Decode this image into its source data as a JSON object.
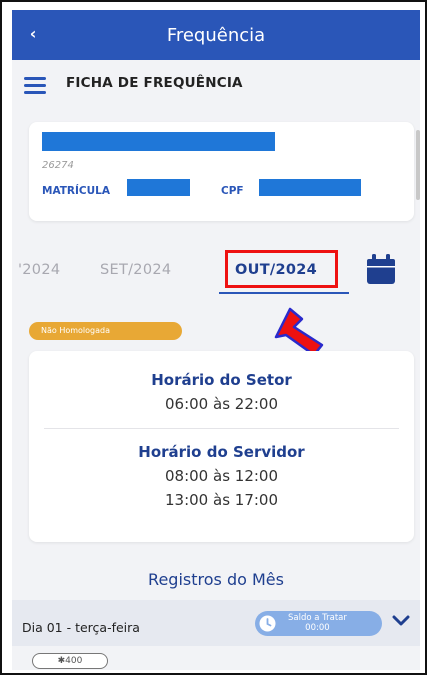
{
  "app_bar": {
    "title": "Frequência",
    "back_icon": "chevron-left-icon"
  },
  "header": {
    "menu_icon": "hamburger-menu-icon",
    "title": "FICHA DE FREQUÊNCIA"
  },
  "user_card": {
    "number": "26274",
    "matricula_label": "MATRÍCULA",
    "cpf_label": "CPF",
    "redaction_color": "#1f77d8"
  },
  "months": {
    "items": [
      "'2024",
      "SET/2024",
      "OUT/2024"
    ],
    "selected": "OUT/2024",
    "calendar_icon": "calendar-icon",
    "annotation_color": "#e11111"
  },
  "status_badge": {
    "label": "Não Homologada",
    "color": "#e8a835"
  },
  "schedule": {
    "setor_title": "Horário do Setor",
    "setor_hours": "06:00 às 22:00",
    "servidor_title": "Horário do Servidor",
    "servidor_hours_1": "08:00 às 12:00",
    "servidor_hours_2": "13:00 às 17:00"
  },
  "records": {
    "title": "Registros do Mês",
    "day_label": "Dia 01 - terça-feira",
    "saldo_label": "Saldo a Tratar",
    "saldo_value": "00:00",
    "clock_icon": "clock-icon",
    "expand_icon": "chevron-down-icon",
    "code": "✱400"
  },
  "colors": {
    "primary": "#2a56b8",
    "accent_text": "#1f3f8f"
  }
}
